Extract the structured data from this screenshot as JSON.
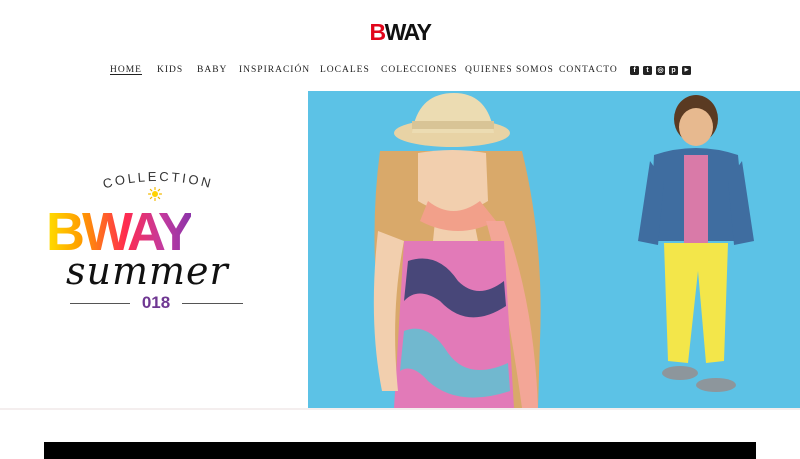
{
  "brand": {
    "logo_b": "B",
    "logo_way": "WAY"
  },
  "nav": {
    "items": [
      {
        "label": "HOME",
        "active": true
      },
      {
        "label": "KIDS",
        "active": false
      },
      {
        "label": "BABY",
        "active": false
      },
      {
        "label": "INSPIRACIÓN",
        "active": false
      },
      {
        "label": "LOCALES",
        "active": false
      },
      {
        "label": "COLECCIONES",
        "active": false
      },
      {
        "label": "QUIENES SOMOS",
        "active": false
      },
      {
        "label": "CONTACTO",
        "active": false
      }
    ]
  },
  "social": {
    "icons": [
      {
        "name": "facebook-icon",
        "glyph": "f"
      },
      {
        "name": "twitter-icon",
        "glyph": "t"
      },
      {
        "name": "instagram-icon",
        "glyph": "◎"
      },
      {
        "name": "pinterest-icon",
        "glyph": "p"
      },
      {
        "name": "youtube-icon",
        "glyph": "▶"
      }
    ]
  },
  "hero": {
    "collection_word": "COLLECTION",
    "brand_big": "BWAY",
    "summer_word": "summer",
    "year": "018"
  },
  "colors": {
    "accent_red": "#e1061b",
    "hero_bg": "#5cc2e6",
    "year_purple": "#6f3792"
  }
}
